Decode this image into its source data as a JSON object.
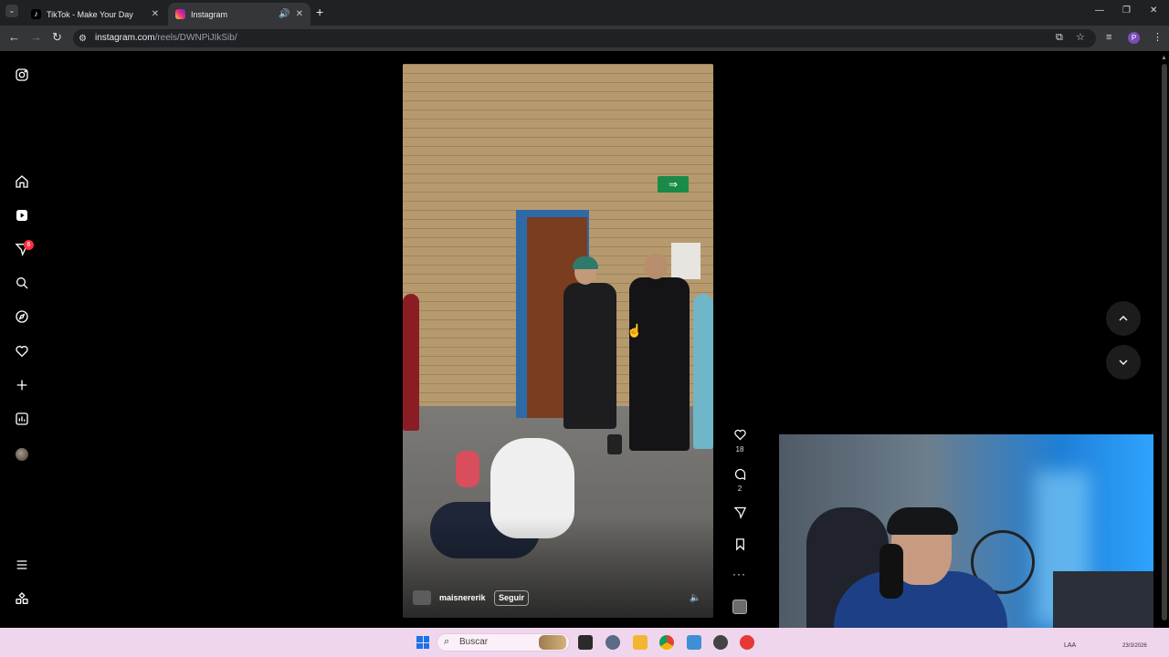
{
  "browser": {
    "tabs": [
      {
        "title": "TikTok - Make Your Day",
        "icon": "tiktok-icon",
        "active": false
      },
      {
        "title": "Instagram",
        "icon": "instagram-icon",
        "active": true
      }
    ],
    "url_host": "instagram.com",
    "url_path": "/reels/DWNPiJIkSib/",
    "profile_initial": "P",
    "profile_color": "#7b4db8"
  },
  "sidebar": {
    "items": [
      {
        "name": "instagram-logo-icon"
      },
      {
        "name": "home-icon"
      },
      {
        "name": "reels-icon"
      },
      {
        "name": "messages-icon",
        "badge": "6"
      },
      {
        "name": "search-icon"
      },
      {
        "name": "explore-icon"
      },
      {
        "name": "notifications-icon"
      },
      {
        "name": "create-icon"
      },
      {
        "name": "dashboard-icon"
      },
      {
        "name": "profile-avatar"
      },
      {
        "name": "more-menu-icon"
      },
      {
        "name": "also-from-meta-icon"
      }
    ]
  },
  "reel": {
    "username": "maisnererik",
    "follow_label": "Seguir",
    "likes": "18",
    "comments": "2",
    "more_label": "···"
  },
  "taskbar": {
    "search_label": "Buscar",
    "tray_lang": "LAA",
    "tray_date": "23/3/2026"
  },
  "colors": {
    "accent": "#ff3040",
    "instagram_bg": "#000000",
    "taskbar_bg": "#f0d6ec"
  }
}
